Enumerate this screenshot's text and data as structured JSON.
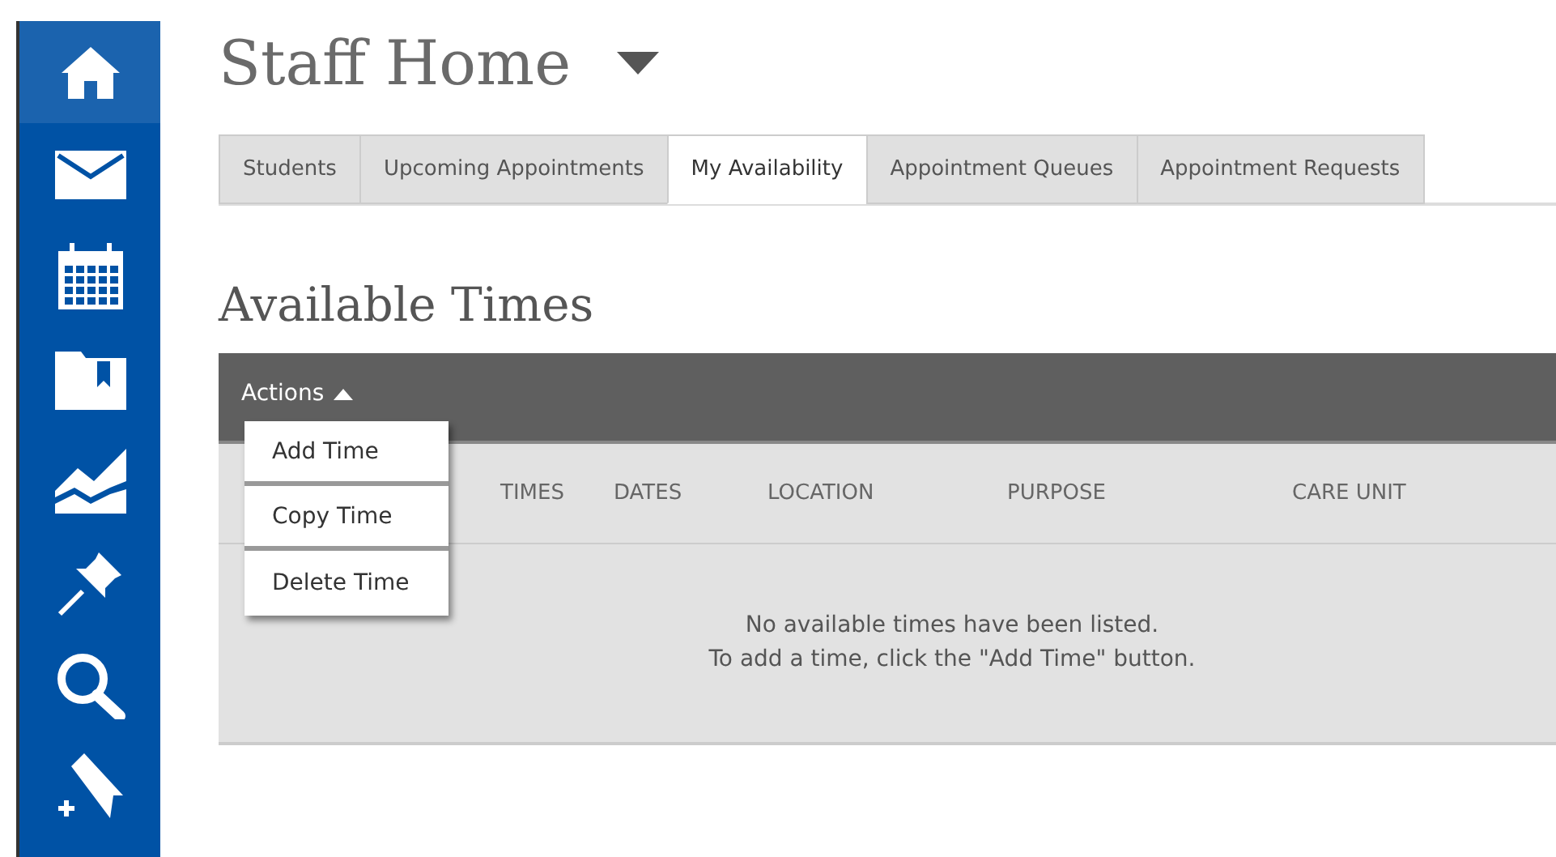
{
  "sidebar": {
    "items": [
      {
        "kind": "home",
        "selected": true
      },
      {
        "kind": "mail",
        "selected": false
      },
      {
        "kind": "calendar",
        "selected": false
      },
      {
        "kind": "folder",
        "selected": false
      },
      {
        "kind": "chart",
        "selected": false
      },
      {
        "kind": "pin",
        "selected": false
      },
      {
        "kind": "search",
        "selected": false
      },
      {
        "kind": "tag",
        "selected": false
      }
    ]
  },
  "page_title": "Staff Home",
  "tabs": [
    {
      "label": "Students",
      "selected": false
    },
    {
      "label": "Upcoming Appointments",
      "selected": false
    },
    {
      "label": "My Availability",
      "selected": true
    },
    {
      "label": "Appointment Queues",
      "selected": false
    },
    {
      "label": "Appointment Requests",
      "selected": false
    }
  ],
  "section_title": "Available Times",
  "actions": {
    "label": "Actions",
    "expanded": true,
    "menu": [
      "Add Time",
      "Copy Time",
      "Delete Time"
    ]
  },
  "table": {
    "columns": [
      "TIMES",
      "DATES",
      "LOCATION",
      "PURPOSE",
      "CARE UNIT"
    ],
    "empty_message": [
      "No available times have been listed.",
      "To add a time, click the \"Add Time\" button."
    ]
  }
}
